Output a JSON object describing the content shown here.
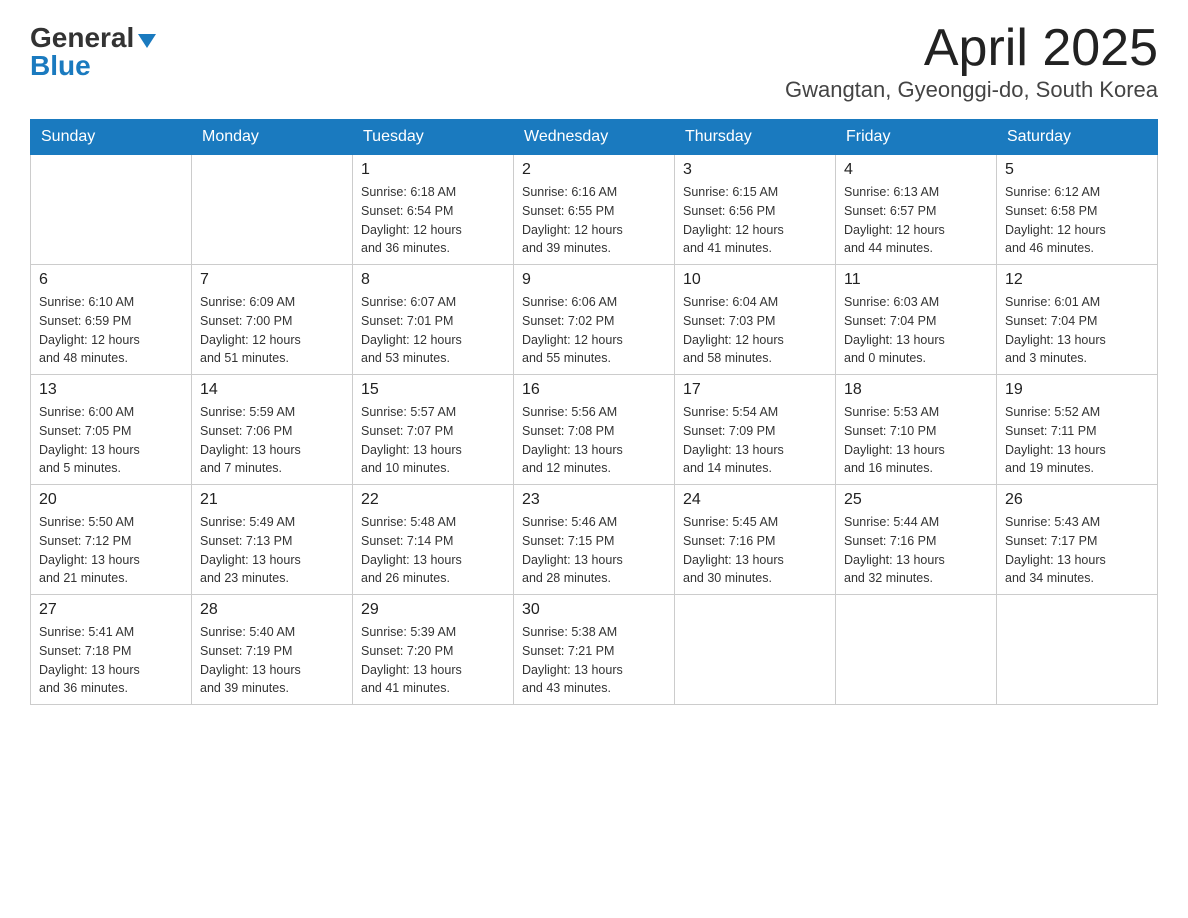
{
  "logo": {
    "general": "General",
    "blue": "Blue"
  },
  "title": "April 2025",
  "subtitle": "Gwangtan, Gyeonggi-do, South Korea",
  "days_of_week": [
    "Sunday",
    "Monday",
    "Tuesday",
    "Wednesday",
    "Thursday",
    "Friday",
    "Saturday"
  ],
  "weeks": [
    [
      {
        "day": "",
        "info": ""
      },
      {
        "day": "",
        "info": ""
      },
      {
        "day": "1",
        "info": "Sunrise: 6:18 AM\nSunset: 6:54 PM\nDaylight: 12 hours\nand 36 minutes."
      },
      {
        "day": "2",
        "info": "Sunrise: 6:16 AM\nSunset: 6:55 PM\nDaylight: 12 hours\nand 39 minutes."
      },
      {
        "day": "3",
        "info": "Sunrise: 6:15 AM\nSunset: 6:56 PM\nDaylight: 12 hours\nand 41 minutes."
      },
      {
        "day": "4",
        "info": "Sunrise: 6:13 AM\nSunset: 6:57 PM\nDaylight: 12 hours\nand 44 minutes."
      },
      {
        "day": "5",
        "info": "Sunrise: 6:12 AM\nSunset: 6:58 PM\nDaylight: 12 hours\nand 46 minutes."
      }
    ],
    [
      {
        "day": "6",
        "info": "Sunrise: 6:10 AM\nSunset: 6:59 PM\nDaylight: 12 hours\nand 48 minutes."
      },
      {
        "day": "7",
        "info": "Sunrise: 6:09 AM\nSunset: 7:00 PM\nDaylight: 12 hours\nand 51 minutes."
      },
      {
        "day": "8",
        "info": "Sunrise: 6:07 AM\nSunset: 7:01 PM\nDaylight: 12 hours\nand 53 minutes."
      },
      {
        "day": "9",
        "info": "Sunrise: 6:06 AM\nSunset: 7:02 PM\nDaylight: 12 hours\nand 55 minutes."
      },
      {
        "day": "10",
        "info": "Sunrise: 6:04 AM\nSunset: 7:03 PM\nDaylight: 12 hours\nand 58 minutes."
      },
      {
        "day": "11",
        "info": "Sunrise: 6:03 AM\nSunset: 7:04 PM\nDaylight: 13 hours\nand 0 minutes."
      },
      {
        "day": "12",
        "info": "Sunrise: 6:01 AM\nSunset: 7:04 PM\nDaylight: 13 hours\nand 3 minutes."
      }
    ],
    [
      {
        "day": "13",
        "info": "Sunrise: 6:00 AM\nSunset: 7:05 PM\nDaylight: 13 hours\nand 5 minutes."
      },
      {
        "day": "14",
        "info": "Sunrise: 5:59 AM\nSunset: 7:06 PM\nDaylight: 13 hours\nand 7 minutes."
      },
      {
        "day": "15",
        "info": "Sunrise: 5:57 AM\nSunset: 7:07 PM\nDaylight: 13 hours\nand 10 minutes."
      },
      {
        "day": "16",
        "info": "Sunrise: 5:56 AM\nSunset: 7:08 PM\nDaylight: 13 hours\nand 12 minutes."
      },
      {
        "day": "17",
        "info": "Sunrise: 5:54 AM\nSunset: 7:09 PM\nDaylight: 13 hours\nand 14 minutes."
      },
      {
        "day": "18",
        "info": "Sunrise: 5:53 AM\nSunset: 7:10 PM\nDaylight: 13 hours\nand 16 minutes."
      },
      {
        "day": "19",
        "info": "Sunrise: 5:52 AM\nSunset: 7:11 PM\nDaylight: 13 hours\nand 19 minutes."
      }
    ],
    [
      {
        "day": "20",
        "info": "Sunrise: 5:50 AM\nSunset: 7:12 PM\nDaylight: 13 hours\nand 21 minutes."
      },
      {
        "day": "21",
        "info": "Sunrise: 5:49 AM\nSunset: 7:13 PM\nDaylight: 13 hours\nand 23 minutes."
      },
      {
        "day": "22",
        "info": "Sunrise: 5:48 AM\nSunset: 7:14 PM\nDaylight: 13 hours\nand 26 minutes."
      },
      {
        "day": "23",
        "info": "Sunrise: 5:46 AM\nSunset: 7:15 PM\nDaylight: 13 hours\nand 28 minutes."
      },
      {
        "day": "24",
        "info": "Sunrise: 5:45 AM\nSunset: 7:16 PM\nDaylight: 13 hours\nand 30 minutes."
      },
      {
        "day": "25",
        "info": "Sunrise: 5:44 AM\nSunset: 7:16 PM\nDaylight: 13 hours\nand 32 minutes."
      },
      {
        "day": "26",
        "info": "Sunrise: 5:43 AM\nSunset: 7:17 PM\nDaylight: 13 hours\nand 34 minutes."
      }
    ],
    [
      {
        "day": "27",
        "info": "Sunrise: 5:41 AM\nSunset: 7:18 PM\nDaylight: 13 hours\nand 36 minutes."
      },
      {
        "day": "28",
        "info": "Sunrise: 5:40 AM\nSunset: 7:19 PM\nDaylight: 13 hours\nand 39 minutes."
      },
      {
        "day": "29",
        "info": "Sunrise: 5:39 AM\nSunset: 7:20 PM\nDaylight: 13 hours\nand 41 minutes."
      },
      {
        "day": "30",
        "info": "Sunrise: 5:38 AM\nSunset: 7:21 PM\nDaylight: 13 hours\nand 43 minutes."
      },
      {
        "day": "",
        "info": ""
      },
      {
        "day": "",
        "info": ""
      },
      {
        "day": "",
        "info": ""
      }
    ]
  ]
}
